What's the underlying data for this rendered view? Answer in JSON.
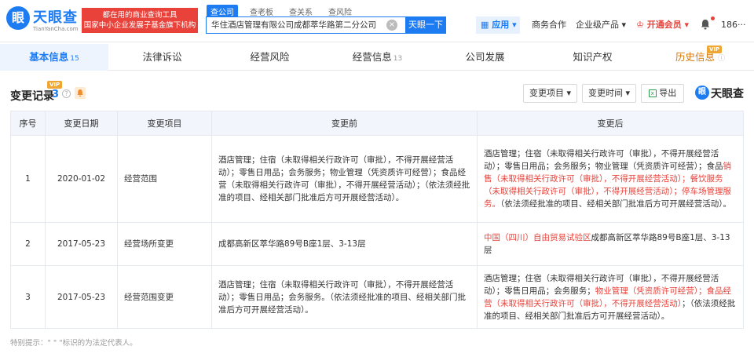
{
  "header": {
    "logo_text": "天眼查",
    "logo_sub": "TianYanCha.com",
    "slogan_line1": "都在用的商业查询工具",
    "slogan_line2": "国家中小企业发展子基金旗下机构",
    "search_tabs": [
      "查公司",
      "查老板",
      "查关系",
      "查风险"
    ],
    "search_value": "华住酒店管理有限公司成都萃华路第二分公司",
    "search_clear": "×",
    "search_button": "天眼一下",
    "app_button": "应用 ▾",
    "nav": {
      "business": "商务合作",
      "enterprise": "企业级产品 ▾",
      "vip": "开通会员 ▾",
      "user": "186‧‧‧"
    }
  },
  "tabs": [
    {
      "label": "基本信息",
      "count": "15"
    },
    {
      "label": "法律诉讼",
      "count": ""
    },
    {
      "label": "经营风险",
      "count": ""
    },
    {
      "label": "经营信息",
      "count": "13"
    },
    {
      "label": "公司发展",
      "count": ""
    },
    {
      "label": "知识产权",
      "count": ""
    },
    {
      "label": "历史信息",
      "count": ""
    }
  ],
  "vip_badge": "VIP",
  "section": {
    "title": "变更记录",
    "count": "3",
    "info_icon": "?",
    "filter_items": "变更项目 ▾",
    "filter_time": "变更时间 ▾",
    "export": "导出",
    "brand": "天眼查"
  },
  "table": {
    "headers": [
      "序号",
      "变更日期",
      "变更项目",
      "变更前",
      "变更后"
    ],
    "rows": [
      {
        "no": "1",
        "date": "2020-01-02",
        "item": "经营范围",
        "before": "酒店管理；住宿（未取得相关行政许可（审批），不得开展经营活动）；零售日用品；会务服务；物业管理（凭资质许可经营）；食品经营（未取得相关行政许可（审批），不得开展经营活动）；（依法须经批准的项目、经相关部门批准后方可开展经营活动）。",
        "after_a": "酒店管理；住宿（未取得相关行政许可（审批），不得开展经营活动）；零售日用品；会务服务；物业管理（凭资质许可经营）；食品",
        "after_hl": "销售（未取得相关行政许可（审批），不得开展经营活动）；餐饮服务（未取得相关行政许可（审批），不得开展经营活动）；停车场管理服务。",
        "after_b": "（依法须经批准的项目、经相关部门批准后方可开展经营活动）。"
      },
      {
        "no": "2",
        "date": "2017-05-23",
        "item": "经营场所变更",
        "before": "成都高新区萃华路89号B座1层、3-13层",
        "after_hl": "中国（四川）自由贸易试验区",
        "after_b": "成都高新区萃华路89号B座1层、3-13层"
      },
      {
        "no": "3",
        "date": "2017-05-23",
        "item": "经营范围变更",
        "before": "酒店管理；住宿（未取得相关行政许可（审批），不得开展经营活动）；零售日用品；会务服务。（依法须经批准的项目、经相关部门批准后方可开展经营活动）。",
        "after_a": "酒店管理；住宿（未取得相关行政许可（审批），不得开展经营活动）；零售日用品；会务服务；",
        "after_hl": "物业管理（凭资质许可经营）；食品经营（未取得相关行政许可（审批），不得开展经营活动）",
        "after_b": "；（依法须经批准的项目、经相关部门批准后方可开展经营活动）。"
      }
    ]
  },
  "footnote": "特别提示：\" \" \"标识的为法定代表人。",
  "colors": {
    "brand": "#1e7cf2",
    "accent_red": "#e8423a",
    "vip": "#f0a632"
  }
}
